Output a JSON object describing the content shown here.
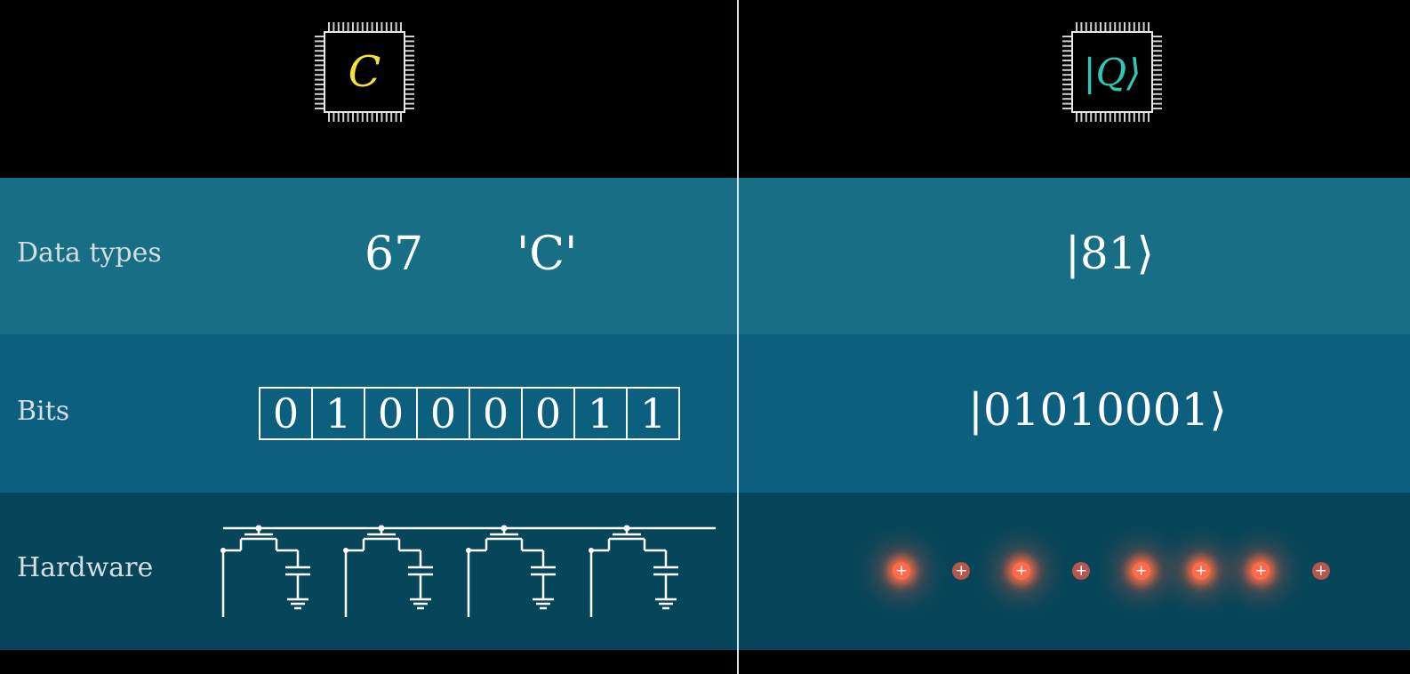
{
  "header": {
    "classical_chip": {
      "glyph": "C",
      "color": "#f4e23a",
      "icon": "cpu-chip-icon"
    },
    "quantum_chip": {
      "glyph": "|Q⟩",
      "color": "#2ec9b5",
      "icon": "cpu-chip-icon"
    }
  },
  "rows": {
    "data_types": {
      "label": "Data types",
      "classical_number": "67",
      "classical_char": "'C'",
      "quantum_ket": "|81⟩"
    },
    "bits": {
      "label": "Bits",
      "classical_bits": [
        "0",
        "1",
        "0",
        "0",
        "0",
        "0",
        "1",
        "1"
      ],
      "quantum_ket": "|01010001⟩"
    },
    "hardware": {
      "label": "Hardware",
      "circuit_icon": "transistor-capacitor-circuit-icon",
      "particle_states": [
        1,
        0,
        1,
        0,
        1,
        1,
        1,
        0
      ],
      "particle_symbol": "+"
    }
  },
  "colors": {
    "band_data_types": "#176e85",
    "band_bits": "#0c5f7e",
    "band_hardware": "#07465a",
    "particle_on": "#ff6a4a",
    "particle_off": "#b5574a"
  }
}
